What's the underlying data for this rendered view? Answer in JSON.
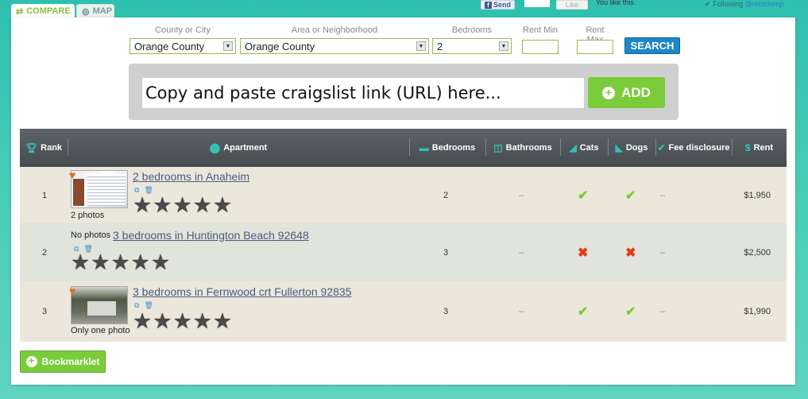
{
  "tabs": {
    "compare": "COMPARE",
    "map": "MAP"
  },
  "social": {
    "send": "Send",
    "like": "Like",
    "like_text": "You like this.",
    "following_prefix": "Following",
    "following_handle": "@rentchimp"
  },
  "filters": {
    "county_label": "County or City",
    "county_value": "Orange County",
    "area_label": "Area or Neighborhood",
    "area_value": "Orange County",
    "bedrooms_label": "Bedrooms",
    "bedrooms_value": "2",
    "rent_min_label": "Rent Min",
    "rent_max_label": "Rent Max",
    "search_label": "SEARCH"
  },
  "url_entry": {
    "placeholder": "Copy and paste craigslist link (URL) here...",
    "add_label": "ADD"
  },
  "table": {
    "headers": {
      "rank": "Rank",
      "apartment": "Apartment",
      "bedrooms": "Bedrooms",
      "bathrooms": "Bathrooms",
      "cats": "Cats",
      "dogs": "Dogs",
      "fee": "Fee disclosure",
      "rent": "Rent"
    },
    "rows": [
      {
        "rank": "1",
        "title": "2 bedrooms in Anaheim",
        "photo_note": "2 photos",
        "bedrooms": "2",
        "bathrooms": "–",
        "cats": "✔",
        "dogs": "✔",
        "fee": "–",
        "rent": "$1,950"
      },
      {
        "rank": "2",
        "title": "3 bedrooms in Huntington Beach 92648",
        "photo_note": "No photos",
        "bedrooms": "3",
        "bathrooms": "–",
        "cats": "✖",
        "dogs": "✖",
        "fee": "–",
        "rent": "$2,500"
      },
      {
        "rank": "3",
        "title": "3 bedrooms in Fernwood crt Fullerton 92835",
        "photo_note": "Only one photo",
        "bedrooms": "3",
        "bathrooms": "–",
        "cats": "✔",
        "dogs": "✔",
        "fee": "–",
        "rent": "$1,990"
      }
    ]
  },
  "bookmarklet_label": "Bookmarklet",
  "colors": {
    "accent_green": "#7acc3a",
    "search_blue": "#1f86c8",
    "header_gray": "#50575b",
    "teal": "#35c0b5"
  }
}
